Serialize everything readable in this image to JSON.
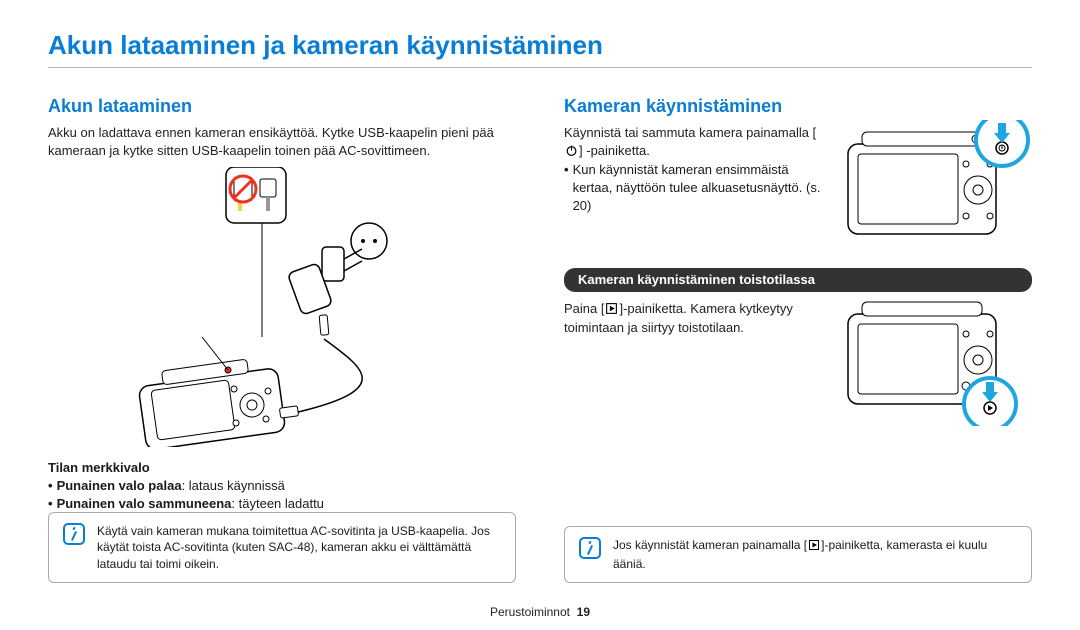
{
  "title": "Akun lataaminen ja kameran käynnistäminen",
  "left": {
    "heading": "Akun lataaminen",
    "intro": "Akku on ladattava ennen kameran ensikäyttöä. Kytke USB-kaapelin pieni pää kameraan ja kytke sitten USB-kaapelin toinen pää AC-sovittimeen.",
    "status_label": "Tilan merkkivalo",
    "led_on_label": "Punainen valo palaa",
    "led_on_desc": ": lataus käynnissä",
    "led_off_label": "Punainen valo sammuneena",
    "led_off_desc": ": täyteen ladattu",
    "note": "Käytä vain kameran mukana toimitettua AC-sovitinta ja USB-kaapelia. Jos käytät toista AC-sovitinta (kuten SAC-48), kameran akku ei välttämättä lataudu tai toimi oikein."
  },
  "right": {
    "heading": "Kameran käynnistäminen",
    "intro_a": "Käynnistä tai sammuta kamera painamalla [",
    "intro_b": "-painiketta.",
    "bullet": "Kun käynnistät kameran ensimmäistä kertaa, näyttöön tulee alkuasetusnäyttö. (s. 20)",
    "pill": "Kameran käynnistäminen toistotilassa",
    "play_a": "Paina [",
    "play_b": "]-painiketta. Kamera kytkeytyy toimintaan ja siirtyy toistotilaan.",
    "note_a": "Jos käynnistät kameran painamalla [",
    "note_b": "]-painiketta, kamerasta ei kuulu ääniä."
  },
  "footer": {
    "section": "Perustoiminnot",
    "page": "19"
  }
}
